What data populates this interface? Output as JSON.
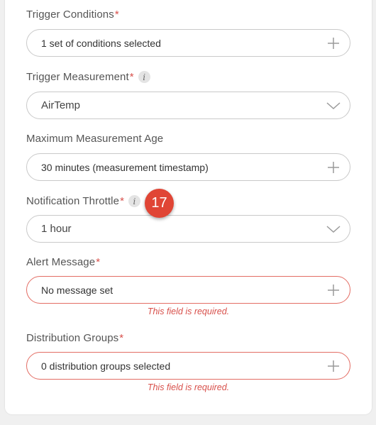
{
  "form": {
    "trigger_conditions": {
      "label": "Trigger Conditions",
      "required_mark": "*",
      "value": "1 set of conditions selected"
    },
    "trigger_measurement": {
      "label": "Trigger Measurement",
      "required_mark": "*",
      "info": "i",
      "value": "AirTemp"
    },
    "max_measurement_age": {
      "label": "Maximum Measurement Age",
      "value": "30 minutes (measurement timestamp)"
    },
    "notification_throttle": {
      "label": "Notification Throttle",
      "required_mark": "*",
      "info": "i",
      "value": "1 hour"
    },
    "alert_message": {
      "label": "Alert Message",
      "required_mark": "*",
      "value": "No message set",
      "error": "This field is required."
    },
    "distribution_groups": {
      "label": "Distribution Groups",
      "required_mark": "*",
      "value": "0 distribution groups selected",
      "error": "This field is required."
    }
  },
  "step_badge": {
    "number": "17"
  },
  "icons": {
    "add": "plus-icon",
    "dropdown": "chevron-down-icon",
    "info": "info-icon"
  },
  "colors": {
    "required": "#d8504b",
    "error_border": "#e36d64",
    "badge": "#e04535"
  }
}
